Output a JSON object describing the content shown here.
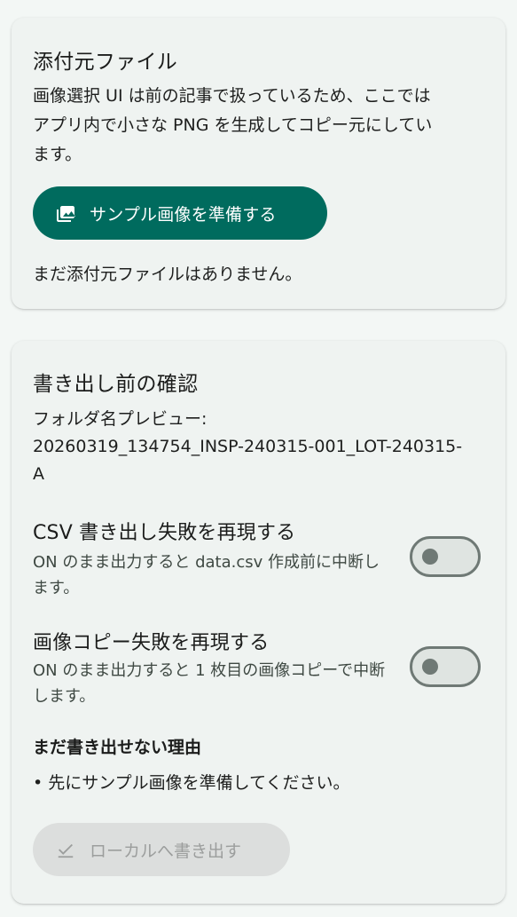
{
  "attachment_card": {
    "title": "添付元ファイル",
    "description_lines": [
      "画像選択 UI は前の記事で扱っているため、ここでは",
      "アプリ内で小さな PNG を生成してコピー元にしてい",
      "ます。"
    ],
    "prepare_button": {
      "label": "サンプル画像を準備する",
      "icon": "image-icon",
      "color": "#006b5e"
    },
    "empty_message": "まだ添付元ファイルはありません。"
  },
  "export_card": {
    "title": "書き出し前の確認",
    "folder_preview_label": "フォルダ名プレビュー:",
    "folder_name_lines": [
      "20260319_134754_INSP-240315-001_LOT-240315-",
      "A"
    ],
    "toggles": [
      {
        "title": "CSV 書き出し失敗を再現する",
        "description": "ON のまま出力すると data.csv 作成前に中断します。",
        "state": "off"
      },
      {
        "title": "画像コピー失敗を再現する",
        "description": "ON のまま出力すると 1 枚目の画像コピーで中断します。",
        "state": "off"
      }
    ],
    "blocked_reason_title": "まだ書き出せない理由",
    "blocked_reasons": [
      "• 先にサンプル画像を準備してください。"
    ],
    "export_button": {
      "label": "ローカルへ書き出す",
      "icon": "check-icon",
      "enabled": false
    }
  }
}
